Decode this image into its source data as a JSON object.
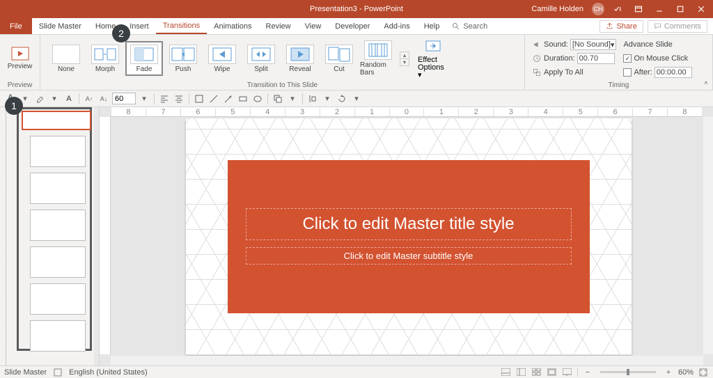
{
  "titlebar": {
    "title": "Presentation3 - PowerPoint",
    "user": "Camille Holden",
    "avatar": "CH"
  },
  "tabs": [
    "File",
    "Slide Master",
    "Home",
    "Insert",
    "Transitions",
    "Animations",
    "Review",
    "View",
    "Developer",
    "Add-ins",
    "Help"
  ],
  "active_tab": "Transitions",
  "search_label": "Search",
  "share_label": "Share",
  "comments_label": "Comments",
  "ribbon": {
    "preview_group": "Preview",
    "preview_btn": "Preview",
    "transition_group": "Transition to This Slide",
    "timing_group": "Timing",
    "transitions": [
      {
        "name": "None"
      },
      {
        "name": "Morph"
      },
      {
        "name": "Fade",
        "selected": true
      },
      {
        "name": "Push"
      },
      {
        "name": "Wipe"
      },
      {
        "name": "Split"
      },
      {
        "name": "Reveal"
      },
      {
        "name": "Cut"
      },
      {
        "name": "Random Bars"
      }
    ],
    "effect_options": "Effect Options",
    "sound_label": "Sound:",
    "sound_value": "[No Sound]",
    "duration_label": "Duration:",
    "duration_value": "00.70",
    "apply_all": "Apply To All",
    "advance_label": "Advance Slide",
    "on_click": "On Mouse Click",
    "on_click_checked": true,
    "after_label": "After:",
    "after_value": "00:00.00",
    "after_checked": false
  },
  "qat": {
    "font_size": "60"
  },
  "slide": {
    "title_ph": "Click to edit Master title style",
    "subtitle_ph": "Click to edit Master subtitle style"
  },
  "ruler_marks": [
    "8",
    "7",
    "6",
    "5",
    "4",
    "3",
    "2",
    "1",
    "0",
    "1",
    "2",
    "3",
    "4",
    "5",
    "6",
    "7",
    "8"
  ],
  "status": {
    "view": "Slide Master",
    "lang": "English (United States)",
    "zoom": "60%"
  },
  "callouts": {
    "c1": "1",
    "c2": "2"
  },
  "colors": {
    "accent": "#b7472a",
    "slide_accent": "#d35230"
  }
}
